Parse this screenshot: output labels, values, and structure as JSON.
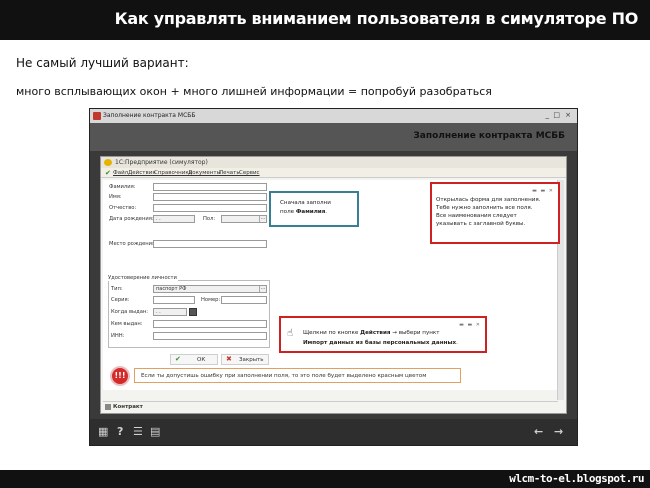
{
  "slide": {
    "title": "Как управлять вниманием пользователя в симуляторе ПО",
    "line1": "Не самый лучший вариант:",
    "line2": "много всплывающих окон + много лишней информации = попробуй разобраться",
    "footer_url": "wlcm-to-el.blogspot.ru"
  },
  "outer_window": {
    "title": "Заполнение контракта МСББ",
    "header": "Заполнение контракта МСББ",
    "controls": [
      "_",
      "□",
      "×"
    ]
  },
  "app": {
    "title": "1С:Предприятие (симулятор)",
    "menu": [
      "Файл",
      "Действия",
      "Справочники",
      "Документы",
      "Печать",
      "Сервис"
    ]
  },
  "form": {
    "labels": {
      "surname": "Фамилия:",
      "name": "Имя:",
      "patronymic": "Отчество:",
      "birth_date": "Дата рождения:",
      "sex": "Пол:",
      "birth_place": "Место рождения:",
      "id_group": "Удостоверение личности",
      "type": "Тип:",
      "series": "Серия:",
      "number": "Номер:",
      "issued_when": "Когда выдан:",
      "issued_by": "Кем выдан:",
      "inn": "ИНН:"
    },
    "values": {
      "birth_date": ". .",
      "type": "паспорт РФ",
      "issued_when": ". ."
    },
    "buttons": {
      "ok": "ОК",
      "close": "Закрыть"
    }
  },
  "callouts": {
    "blue": [
      "Сначала заполни",
      "поле ",
      "Фамилия",
      "."
    ],
    "red_top": [
      "Открылась форма для заполнения.",
      "Тебе нужно заполнить все поля.",
      "Все наименования следует",
      "указывать с заглавной буквы."
    ],
    "red_mid_1": "Щелкни по кнопке ",
    "red_mid_actions": "Действия",
    "red_mid_2": " → выбери пункт",
    "red_mid_import": "Импорт данных из базы персональных данных",
    "red_mid_end": ".",
    "warning": "Если ты допустишь ошибку при заполнении поля, то это поле будет выделено красным цветом",
    "warning_icon_text": "!!!"
  },
  "status": {
    "tab": "Контракт"
  },
  "icons": [
    "grid-icon",
    "help-icon",
    "menu-icon",
    "print-icon",
    "back-arrow-icon",
    "forward-arrow-icon"
  ],
  "colors": {
    "callout_blue": "#3a7e96",
    "callout_red": "#cc2222",
    "warning_red": "#d42a2a"
  }
}
